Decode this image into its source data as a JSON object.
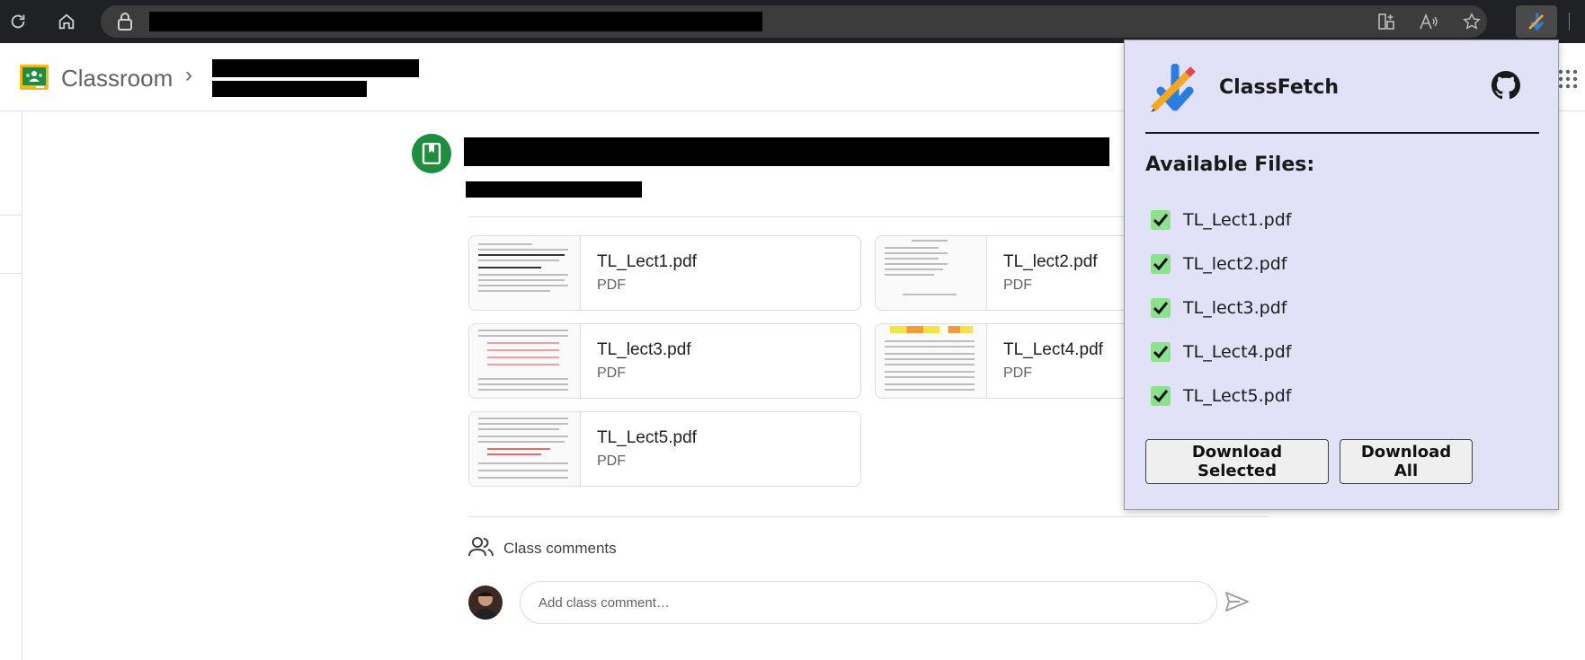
{
  "browser": {
    "extension_name": "ClassFetch"
  },
  "classroom": {
    "app_title": "Classroom"
  },
  "attachments": [
    {
      "name": "TL_Lect1.pdf",
      "type": "PDF"
    },
    {
      "name": "TL_lect2.pdf",
      "type": "PDF"
    },
    {
      "name": "TL_lect3.pdf",
      "type": "PDF"
    },
    {
      "name": "TL_Lect4.pdf",
      "type": "PDF"
    },
    {
      "name": "TL_Lect5.pdf",
      "type": "PDF"
    }
  ],
  "comments": {
    "label": "Class comments",
    "placeholder": "Add class comment…"
  },
  "popup": {
    "title": "ClassFetch",
    "files_heading": "Available Files:",
    "files": [
      {
        "label": "TL_Lect1.pdf",
        "checked": true
      },
      {
        "label": "TL_lect2.pdf",
        "checked": true
      },
      {
        "label": "TL_lect3.pdf",
        "checked": true
      },
      {
        "label": "TL_Lect4.pdf",
        "checked": true
      },
      {
        "label": "TL_Lect5.pdf",
        "checked": true
      }
    ],
    "download_selected_label": "Download Selected",
    "download_all_label": "Download All"
  },
  "colors": {
    "popup_bg": "#e1e1f7",
    "checkbox_green": "#8be28b",
    "material_green": "#1e8e3e"
  }
}
